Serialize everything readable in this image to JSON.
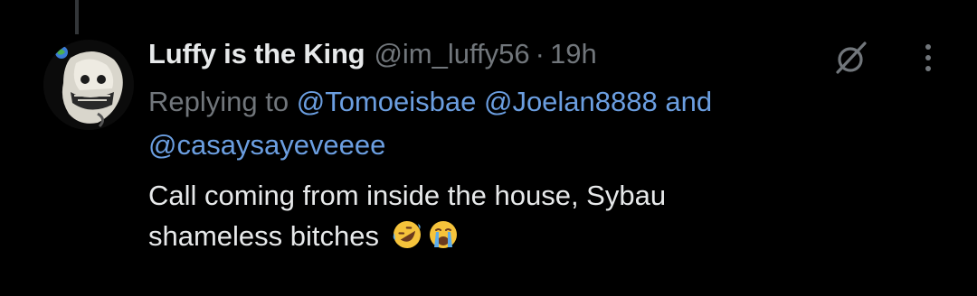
{
  "tweet": {
    "display_name": "Luffy is the King",
    "handle": "@im_luffy56",
    "separator": "·",
    "timestamp": "19h",
    "replying_to_label": "Replying to",
    "mentions": [
      "@Tomoeisbae",
      "@Joelan8888",
      "@casaysayeveeee"
    ],
    "mentions_joiner": "and",
    "text_line1": "Call coming from inside the house, Sybau",
    "text_line2": "shameless bitches",
    "emojis": [
      "rolling-on-floor-laughing-emoji",
      "loudly-crying-emoji"
    ]
  },
  "icons": {
    "grok": "grok-slash-icon",
    "more": "more-vertical-icon"
  },
  "colors": {
    "background": "#000000",
    "primary_text": "#e7e9ea",
    "secondary_text": "#71767b",
    "mention": "#6b9ee0",
    "thread_line": "#333639"
  }
}
